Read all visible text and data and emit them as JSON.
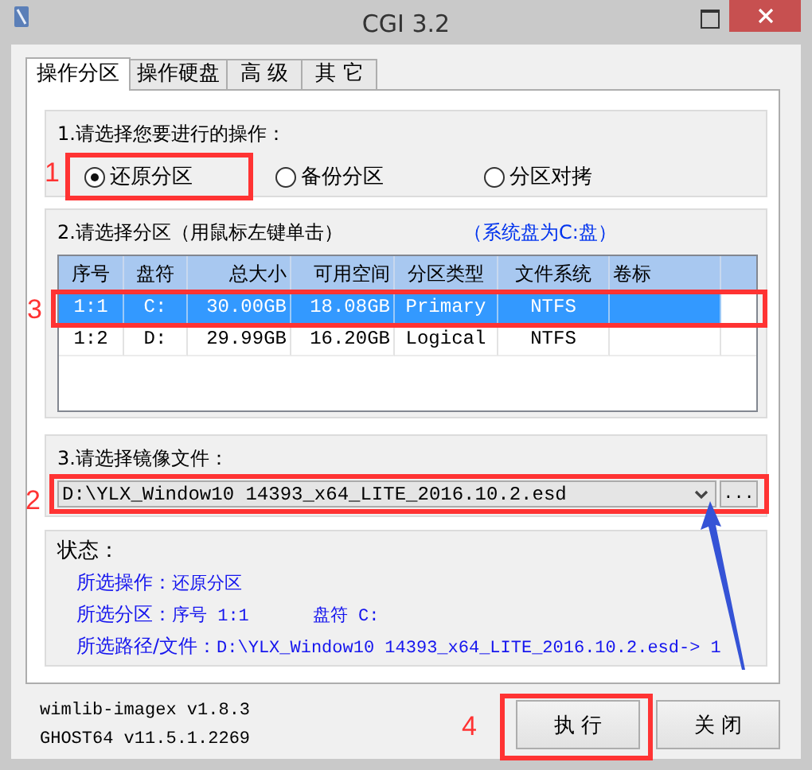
{
  "window": {
    "title": "CGI 3.2"
  },
  "tabs": [
    {
      "label": "操作分区",
      "selected": true
    },
    {
      "label": "操作硬盘",
      "selected": false
    },
    {
      "label": "高 级",
      "selected": false
    },
    {
      "label": "其 它",
      "selected": false
    }
  ],
  "operation": {
    "label": "1.请选择您要进行的操作：",
    "options": [
      {
        "label": "还原分区",
        "selected": true,
        "annotation": "1"
      },
      {
        "label": "备份分区",
        "selected": false
      },
      {
        "label": "分区对拷",
        "selected": false
      }
    ]
  },
  "partition": {
    "label": "2.请选择分区（用鼠标左键单击）",
    "note": "（系统盘为C:盘）",
    "columns": [
      "序号",
      "盘符",
      "总大小",
      "可用空间",
      "分区类型",
      "文件系统",
      "卷标"
    ],
    "rows": [
      {
        "cells": [
          "1:1",
          "C:",
          "30.00GB",
          "18.08GB",
          "Primary",
          "NTFS"
        ],
        "selected": true,
        "annotation": "3"
      },
      {
        "cells": [
          "1:2",
          "D:",
          "29.99GB",
          "16.20GB",
          "Logical",
          "NTFS"
        ],
        "selected": false
      }
    ]
  },
  "image_file": {
    "label": "3.请选择镜像文件：",
    "value": "D:\\YLX_Window10 14393_x64_LITE_2016.10.2.esd",
    "browse_label": "...",
    "annotation": "2"
  },
  "status": {
    "label": "状态：",
    "lines": [
      {
        "label": "所选操作：",
        "values": [
          "还原分区"
        ]
      },
      {
        "label": "所选分区：",
        "values": [
          "序号 1:1",
          "盘符 C:"
        ]
      },
      {
        "label": "所选路径/文件：",
        "values": [
          "D:\\YLX_Window10 14393_x64_LITE_2016.10.2.esd->  1"
        ]
      }
    ]
  },
  "versions": [
    "wimlib-imagex v1.8.3",
    "GHOST64 v11.5.1.2269"
  ],
  "buttons": [
    {
      "label": "执 行",
      "annotation": "4"
    },
    {
      "label": "关 闭"
    }
  ]
}
